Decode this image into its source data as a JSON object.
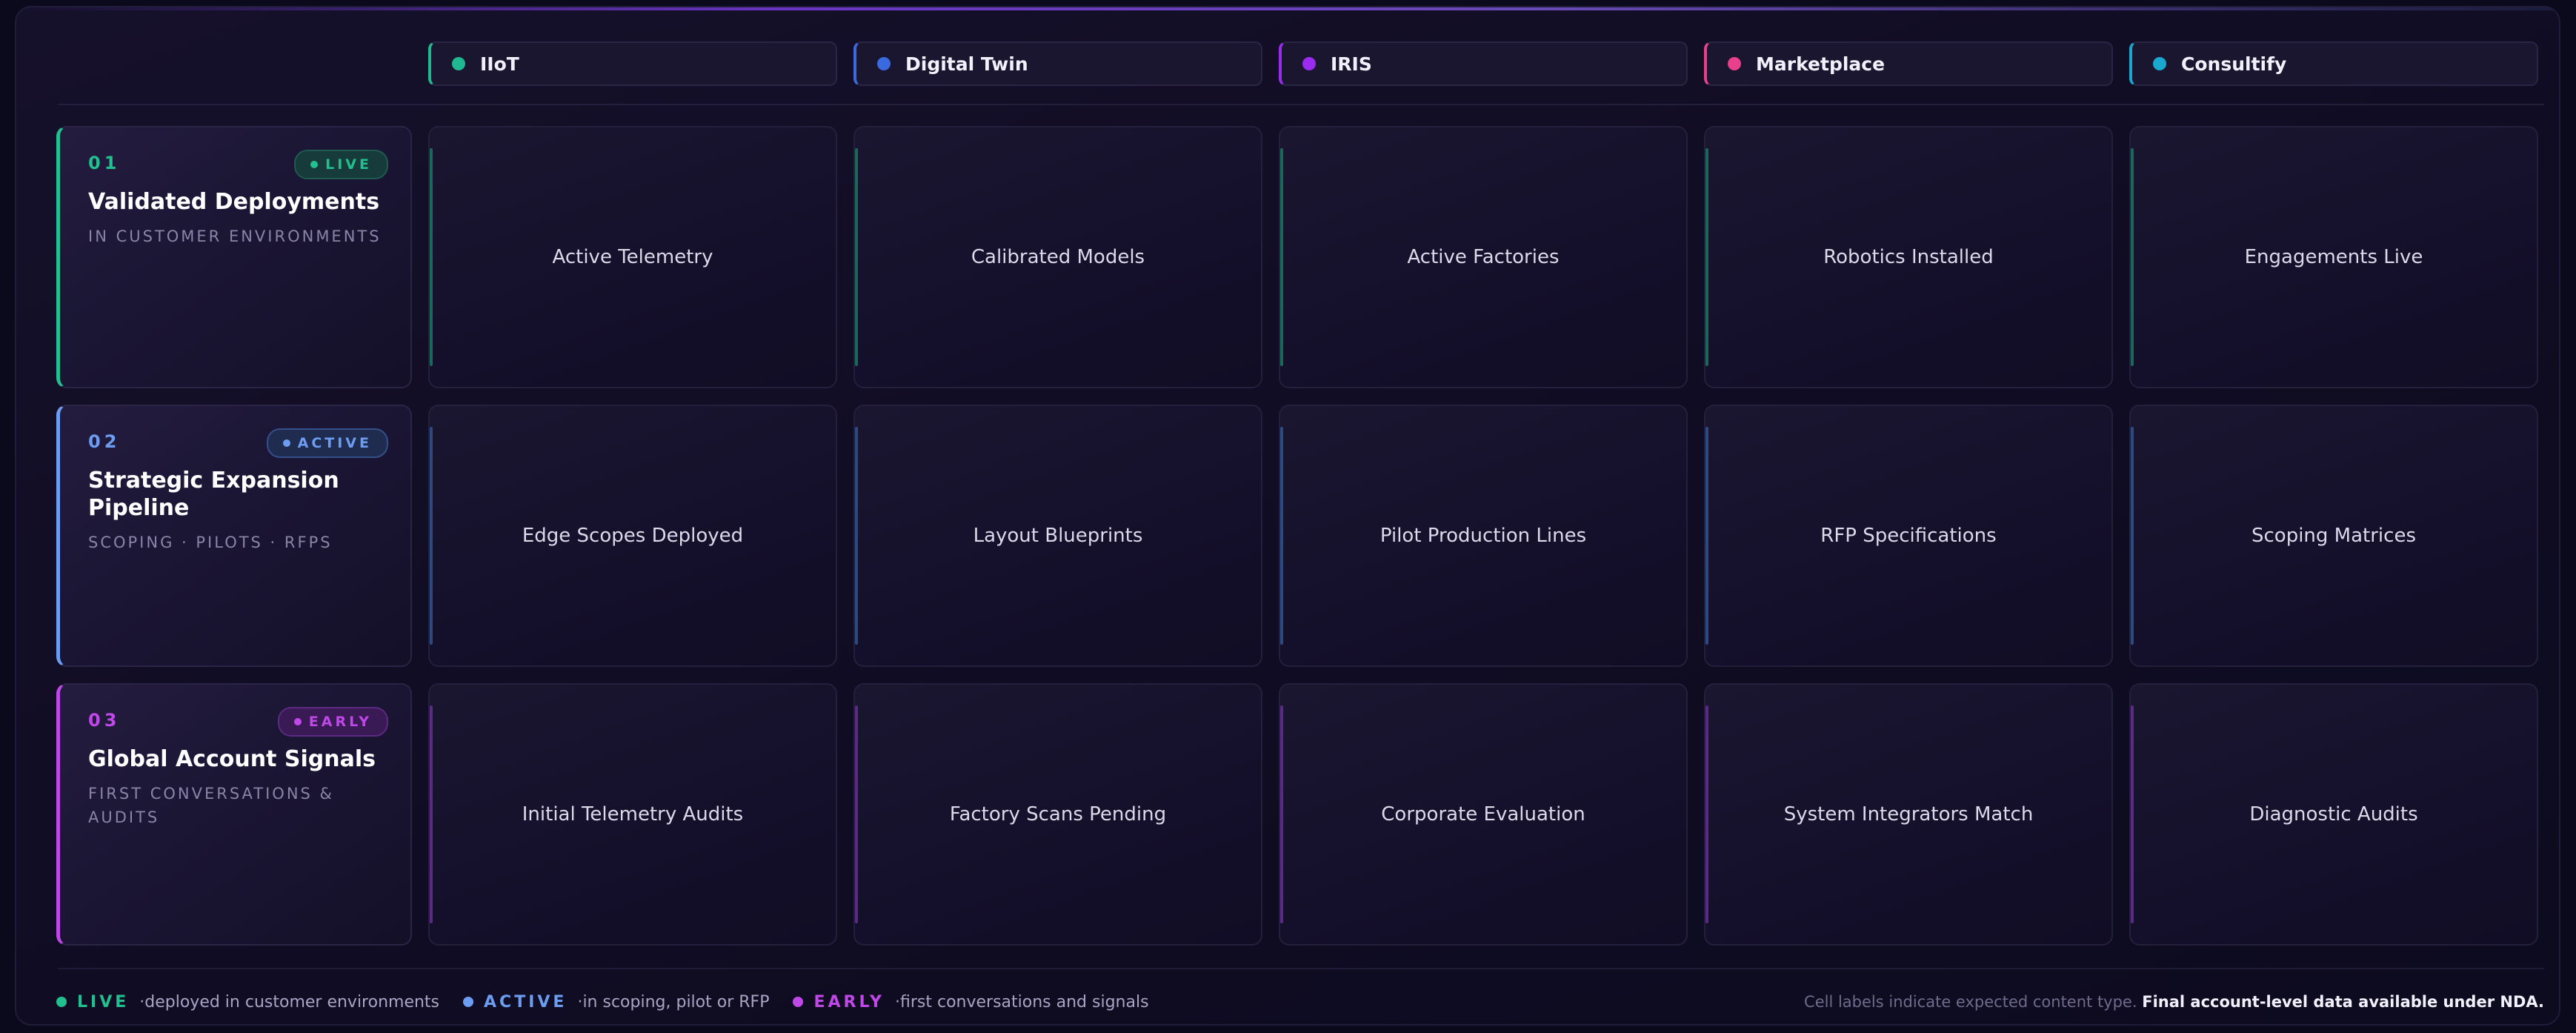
{
  "columns": [
    {
      "label": "IIoT",
      "color": "#1fb890"
    },
    {
      "label": "Digital Twin",
      "color": "#3b6ae0"
    },
    {
      "label": "IRIS",
      "color": "#9a2cf0"
    },
    {
      "label": "Marketplace",
      "color": "#e8408a"
    },
    {
      "label": "Consultify",
      "color": "#1aa8d0"
    }
  ],
  "rows": [
    {
      "num": "01",
      "badge": "LIVE",
      "title": "Validated Deployments",
      "subtitle": "IN CUSTOMER ENVIRONMENTS",
      "color": "#22c08e",
      "badge_bg": "#173a3a",
      "badge_border": "#1f5a50",
      "stripe": "#18695a",
      "cells": [
        "Active Telemetry",
        "Calibrated Models",
        "Active Factories",
        "Robotics Installed",
        "Engagements Live"
      ]
    },
    {
      "num": "02",
      "badge": "ACTIVE",
      "title": "Strategic Expansion Pipeline",
      "subtitle": "SCOPING · PILOTS · RFPS",
      "color": "#6c9df0",
      "badge_bg": "#1f2c50",
      "badge_border": "#34508a",
      "stripe": "#2c4a82",
      "cells": [
        "Edge Scopes Deployed",
        "Layout Blueprints",
        "Pilot Production Lines",
        "RFP Specifications",
        "Scoping Matrices"
      ]
    },
    {
      "num": "03",
      "badge": "EARLY",
      "title": "Global Account Signals",
      "subtitle": "FIRST CONVERSATIONS & AUDITS",
      "color": "#c048e8",
      "badge_bg": "#3a1a55",
      "badge_border": "#5c2a80",
      "stripe": "#5a2a86",
      "cells": [
        "Initial Telemetry Audits",
        "Factory Scans Pending",
        "Corporate Evaluation",
        "System Integrators Match",
        "Diagnostic Audits"
      ]
    }
  ],
  "legend": [
    {
      "key": "LIVE",
      "text": "·deployed in customer environments",
      "color": "#22c08e"
    },
    {
      "key": "ACTIVE",
      "text": "·in scoping, pilot or RFP",
      "color": "#6c9df0"
    },
    {
      "key": "EARLY",
      "text": "·first conversations and signals",
      "color": "#c048e8"
    }
  ],
  "note": {
    "prefix": "Cell labels indicate expected content type.",
    "bold": "Final account-level data available under NDA."
  }
}
